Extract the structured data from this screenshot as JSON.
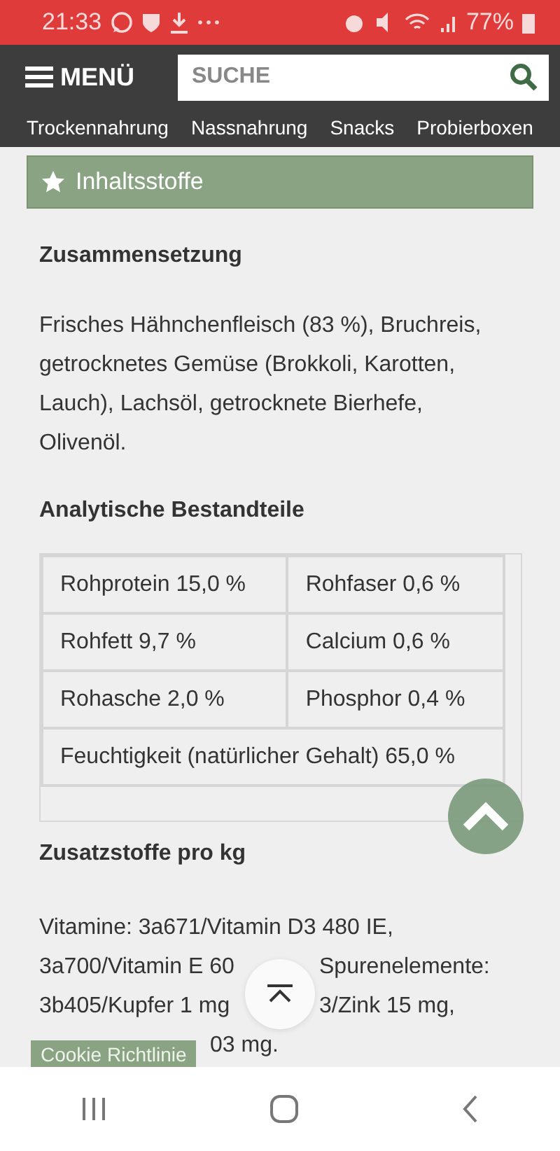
{
  "status_bar": {
    "time": "21:33",
    "battery": "77%"
  },
  "header": {
    "menu_label": "MENÜ",
    "search": {
      "placeholder": "SUCHE"
    },
    "nav": [
      "Trockennahrung",
      "Nassnahrung",
      "Snacks",
      "Probierboxen"
    ]
  },
  "section": {
    "title": "Inhaltsstoffe"
  },
  "composition": {
    "heading": "Zusammensetzung",
    "text": "Frisches Hähnchenfleisch (83 %), Bruchreis, getrocknetes Gemüse (Brokkoli, Karotten, Lauch), Lachsöl, getrocknete Bierhefe, Olivenöl."
  },
  "analytics": {
    "heading": "Analytische Bestandteile",
    "rows": [
      [
        {
          "text": "Rohprotein 15,0 %"
        },
        {
          "text": "Rohfaser 0,6 %"
        }
      ],
      [
        {
          "text": "Rohfett 9,7 %"
        },
        {
          "text": "Calcium 0,6 %"
        }
      ],
      [
        {
          "text": "Rohasche 2,0 %"
        },
        {
          "text": "Phosphor 0,4 %"
        }
      ],
      [
        {
          "text": "Feuchtigkeit (natürlicher Gehalt) 65,0 %",
          "colspan": 2
        }
      ]
    ]
  },
  "additives": {
    "heading": "Zusatzstoffe pro kg",
    "lines": [
      {
        "kind": "full",
        "parts": [
          "Vitamine: 3a671/Vitamin D3 480 IE,"
        ]
      },
      {
        "kind": "split",
        "parts": [
          "3a700/Vitamin E 60",
          "Spurenelemente:"
        ]
      },
      {
        "kind": "split",
        "parts": [
          "3b405/Kupfer 1 mg",
          "3/Zink 15 mg,"
        ]
      },
      {
        "kind": "tail",
        "parts": [
          "03 mg."
        ]
      }
    ]
  },
  "cookie_button": "Cookie Richtlinie"
}
